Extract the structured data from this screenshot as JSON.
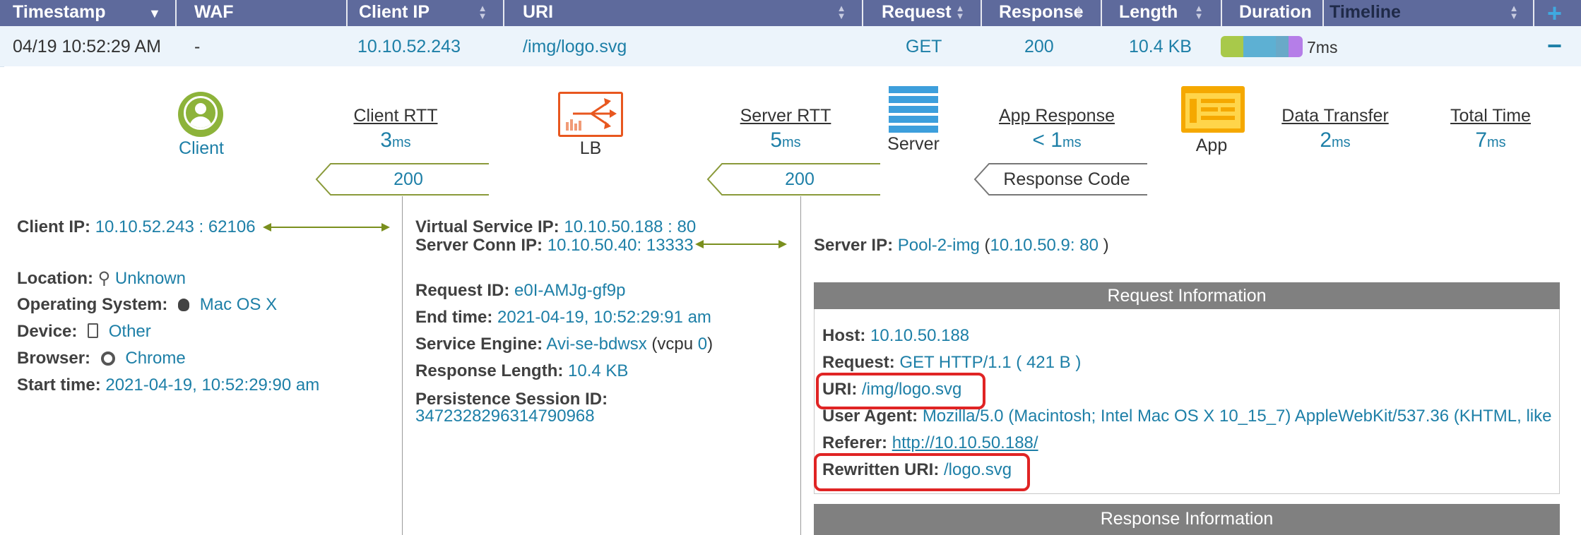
{
  "header": {
    "columns": [
      "Timestamp",
      "WAF",
      "Client IP",
      "URI",
      "Request",
      "Response",
      "Length",
      "Duration",
      "Timeline"
    ]
  },
  "row": {
    "timestamp": "04/19 10:52:29 AM",
    "waf": "-",
    "client_ip": "10.10.52.243",
    "uri": "/img/logo.svg",
    "request": "GET",
    "response": "200",
    "length": "10.4 KB",
    "duration": "7ms",
    "collapse": "−"
  },
  "flow": {
    "client_label": "Client",
    "lb_label": "LB",
    "server_label": "Server",
    "app_label": "App",
    "client_rtt": {
      "title": "Client RTT",
      "value": "3",
      "unit": "ms"
    },
    "server_rtt": {
      "title": "Server RTT",
      "value": "5",
      "unit": "ms"
    },
    "app_response": {
      "title": "App Response",
      "value": "< 1",
      "unit": "ms"
    },
    "data_transfer": {
      "title": "Data Transfer",
      "value": "2",
      "unit": "ms"
    },
    "total_time": {
      "title": "Total Time",
      "value": "7",
      "unit": "ms"
    },
    "code_client": "200",
    "code_lb": "200",
    "response_code_label": "Response Code"
  },
  "client": {
    "ip_label": "Client IP:",
    "ip_value": "10.10.52.243 : 62106",
    "location_label": "Location:",
    "location_value": "Unknown",
    "os_label": "Operating System:",
    "os_value": "Mac OS X",
    "device_label": "Device:",
    "device_value": "Other",
    "browser_label": "Browser:",
    "browser_value": "Chrome",
    "start_label": "Start time:",
    "start_value": "2021-04-19, 10:52:29:90 am"
  },
  "lb": {
    "vs_label": "Virtual Service IP:",
    "vs_value": "10.10.50.188 : 80",
    "conn_label": "Server Conn IP:",
    "conn_value": "10.10.50.40: 13333",
    "reqid_label": "Request ID:",
    "reqid_value": "e0I-AMJg-gf9p",
    "end_label": "End time:",
    "end_value": "2021-04-19, 10:52:29:91 am",
    "se_label": "Service Engine:",
    "se_value": "Avi-se-bdwsx",
    "se_vcpu_pre": "(vcpu ",
    "se_vcpu_val": "0",
    "se_vcpu_post": ")",
    "resp_len_label": "Response Length:",
    "resp_len_value": "10.4 KB",
    "persist_label": "Persistence Session ID:",
    "persist_value": "3472328296314790968"
  },
  "server": {
    "ip_label": "Server IP:",
    "pool": "Pool-2-img",
    "open": " (",
    "ip": "10.10.50.9",
    "port": ": 80",
    "close": " )"
  },
  "request_info": {
    "title": "Request Information",
    "host_label": "Host:",
    "host_value": "10.10.50.188",
    "request_label": "Request:",
    "request_value": "GET HTTP/1.1 ( 421 B )",
    "uri_label": "URI:",
    "uri_value": "/img/logo.svg",
    "ua_label": "User Agent:",
    "ua_value": "Mozilla/5.0 (Macintosh; Intel Mac OS X 10_15_7) AppleWebKit/537.36 (KHTML, like",
    "referer_label": "Referer:",
    "referer_value": "http://10.10.50.188/",
    "rewritten_label": "Rewritten URI:",
    "rewritten_value": "/logo.svg"
  },
  "response_info": {
    "title": "Response Information"
  },
  "colors": {
    "header_bg": "#5e6a9c",
    "accent": "#1d7fa7",
    "client_green": "#8db33a",
    "lb_orange": "#e8571f",
    "server_blue": "#3d9fdc",
    "app_yellow": "#f5a800",
    "highlight_red": "#e02424",
    "timeline_segments": [
      "#a8c94a",
      "#5db0d3",
      "#69a9c8",
      "#b57ee8"
    ]
  }
}
